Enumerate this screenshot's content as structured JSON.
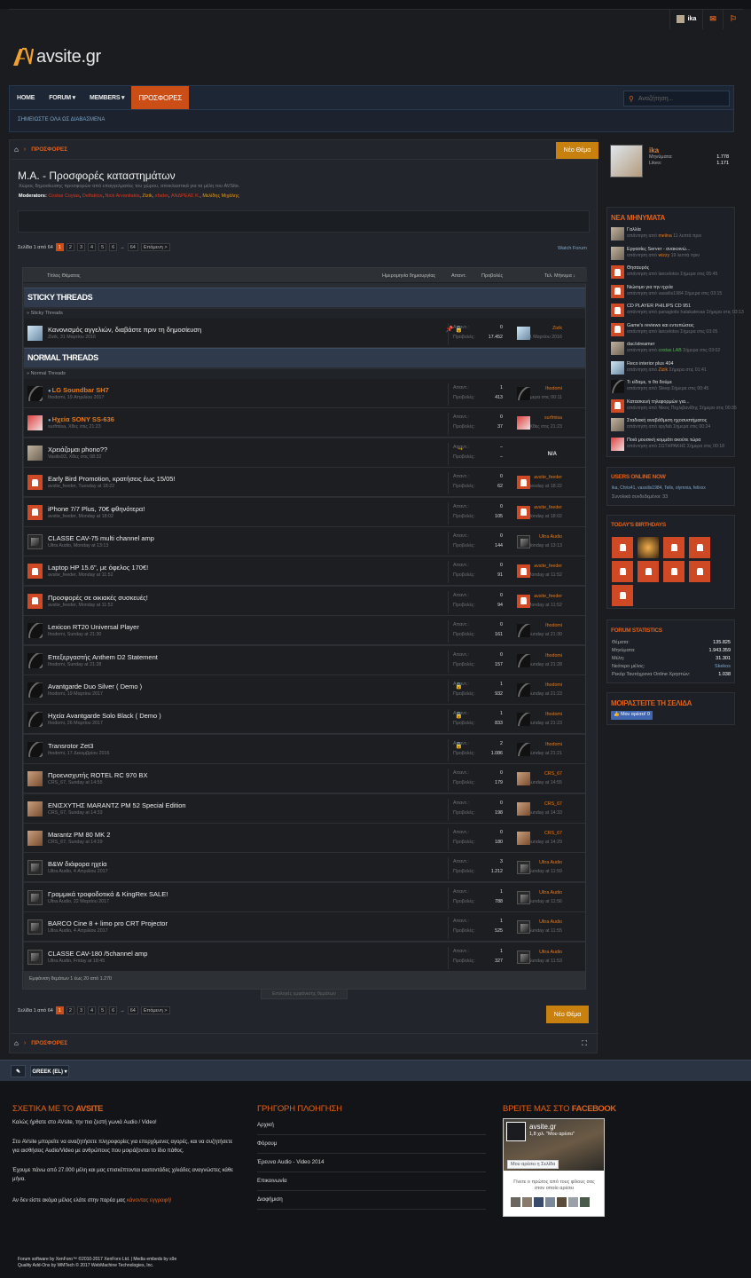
{
  "site": {
    "name": "avsite.gr"
  },
  "userbar": {
    "username": "ika"
  },
  "nav": {
    "items": [
      {
        "label": "HOME",
        "active": false
      },
      {
        "label": "FORUM ▾",
        "active": false
      },
      {
        "label": "MEMBERS ▾",
        "active": false
      },
      {
        "label": "ΠΡΟΣΦΟΡΕΣ",
        "active": true
      }
    ],
    "search_placeholder": "Αναζήτηση...",
    "subnav_link": "ΣΗΜΕΙΩΣΤΕ ΟΛΑ ΩΣ ΔΙΑΒΑΣΜΕΝΑ"
  },
  "breadcrumb": {
    "current": "ΠΡΟΣΦΟΡΕΣ"
  },
  "new_thread_label": "Νέο Θέμα",
  "forum": {
    "title": "Μ.Α. - Προσφορές καταστημάτων",
    "description": "Χώρος δημοσίευσης προσφορών από επαγγελματίες του χώρου, αποκλειστικά για τα μέλη του AVSite.",
    "moderators_label": "Moderators:",
    "moderators": [
      "Costas Coyias",
      "Delfaklos",
      "Nick Arvanitakis",
      "Zizik",
      "xfader",
      "ΑΝΔΡΕΑΣ Κ.",
      "Μελίδης Μιχάλης"
    ],
    "watch_label": "Watch Forum"
  },
  "pagination": {
    "label": "Σελίδα 1 από 64",
    "pages": [
      "1",
      "2",
      "3",
      "4",
      "5",
      "6",
      "→",
      "64"
    ],
    "next": "Επόμενη >"
  },
  "table": {
    "headers": {
      "title": "Τίτλος Θέματος",
      "created": "Ημερομηνία δημιουργίας",
      "replies": "Απαντ.",
      "views": "Προβολές",
      "last": "Τελ. Μήνυμα ↓"
    },
    "sticky_header": "STICKY THREADS",
    "sticky_sub": "» Sticky Threads",
    "normal_header": "NORMAL THREADS",
    "normal_sub": "» Normal Threads",
    "replies_label": "Απαντ.:",
    "views_label": "Προβολές:",
    "footer": "Εμφάνιση θεμάτων 1 έως 20 από 1.270",
    "select_label": "Επιλογές εμφάνισης θεμάτων"
  },
  "sticky_threads": [
    {
      "title": "Κανονισμός αγγελιών, διαβάστε πριν τη δημοσίευση",
      "meta": "Zizik, 31 Μαρτίου 2016",
      "icons": "📌 🔒",
      "replies": "0",
      "views": "17.452",
      "last_user": "Zizik",
      "last_time": "31 Μαρτίου 2016",
      "avatar": "zizik",
      "last_avatar": "zizik",
      "hl": false
    }
  ],
  "threads": [
    {
      "title": "LG Soundbar SH7",
      "meta": "Ihodomi, 19 Απριλίου 2017",
      "icons": "",
      "replies": "1",
      "views": "413",
      "last_user": "Ihodomi",
      "last_time": "Σήμερα στις 00:11",
      "avatar": "ihod",
      "last_avatar": "ihod",
      "hl": true,
      "dot": true
    },
    {
      "title": "Ηχεία SONY SS-636",
      "meta": "surfmisa, Χθες στις 21:23",
      "icons": "",
      "replies": "0",
      "views": "37",
      "last_user": "surfmisa",
      "last_time": "Χθες στις 21:23",
      "avatar": "surf",
      "last_avatar": "surf",
      "hl": true,
      "dot": true
    },
    {
      "title": "Χρειάζομαι phono??",
      "meta": "Vasilis93, Χθες στις 08:32",
      "icons": "↪",
      "replies": "–",
      "views": "–",
      "last_user": "",
      "last_time": "",
      "na": "N/A",
      "avatar": "vas",
      "last_avatar": "",
      "hl": false
    },
    {
      "title": "Early Bird Promotion, κρατήσεις έως 15/05!",
      "meta": "avsite_feeder, Tuesday at 18:22",
      "icons": "",
      "replies": "0",
      "views": "62",
      "last_user": "avsite_feeder",
      "last_time": "Tuesday at 18:22",
      "avatar": "def",
      "last_avatar": "def",
      "hl": false
    },
    {
      "title": "iPhone 7/7 Plus, 70€ φθηνότερα!",
      "meta": "avsite_feeder, Monday at 18:02",
      "icons": "",
      "replies": "0",
      "views": "105",
      "last_user": "avsite_feeder",
      "last_time": "Monday at 18:02",
      "avatar": "def",
      "last_avatar": "def",
      "hl": false
    },
    {
      "title": "CLASSE CAV-75 multi channel amp",
      "meta": "Ultra Audio, Monday at 13:13",
      "icons": "",
      "replies": "0",
      "views": "144",
      "last_user": "Ultra Audio",
      "last_time": "Monday at 13:13",
      "avatar": "ultra",
      "last_avatar": "ultra",
      "hl": false
    },
    {
      "title": "Laptop HP 15.6\", με όφελος 170€!",
      "meta": "avsite_feeder, Monday at 11:52",
      "icons": "",
      "replies": "0",
      "views": "91",
      "last_user": "avsite_feeder",
      "last_time": "Monday at 11:52",
      "avatar": "def",
      "last_avatar": "def",
      "hl": false
    },
    {
      "title": "Προσφορές σε οικιακές συσκευές!",
      "meta": "avsite_feeder, Monday at 11:52",
      "icons": "",
      "replies": "0",
      "views": "94",
      "last_user": "avsite_feeder",
      "last_time": "Monday at 11:52",
      "avatar": "def",
      "last_avatar": "def",
      "hl": false
    },
    {
      "title": "Lexicon RT20 Universal Player",
      "meta": "Ihodomi, Sunday at 21:30",
      "icons": "",
      "replies": "0",
      "views": "161",
      "last_user": "Ihodomi",
      "last_time": "Sunday at 21:30",
      "avatar": "ihod",
      "last_avatar": "ihod",
      "hl": false
    },
    {
      "title": "Επεξεργαστής Anthem D2 Statement",
      "meta": "Ihodomi, Sunday at 21:28",
      "icons": "",
      "replies": "0",
      "views": "157",
      "last_user": "Ihodomi",
      "last_time": "Sunday at 21:28",
      "avatar": "ihod",
      "last_avatar": "ihod",
      "hl": false
    },
    {
      "title": "Avantgarde Duo Silver ( Demo )",
      "meta": "Ihodomi, 19 Μαρτίου 2017",
      "icons": "🔒",
      "replies": "1",
      "views": "932",
      "last_user": "Ihodomi",
      "last_time": "Sunday at 21:23",
      "avatar": "ihod",
      "last_avatar": "ihod",
      "hl": false
    },
    {
      "title": "Ηχεία Avantgarde Solo Black ( Demo )",
      "meta": "Ihodomi, 26 Μαρτίου 2017",
      "icons": "🔒",
      "replies": "1",
      "views": "833",
      "last_user": "Ihodomi",
      "last_time": "Sunday at 21:23",
      "avatar": "ihod",
      "last_avatar": "ihod",
      "hl": false
    },
    {
      "title": "Transrotor Zet3",
      "meta": "Ihodomi, 17 Δεκεμβρίου 2016",
      "icons": "🔒",
      "replies": "2",
      "views": "1.086",
      "last_user": "Ihodomi",
      "last_time": "Sunday at 21:21",
      "avatar": "ihod",
      "last_avatar": "ihod",
      "hl": false
    },
    {
      "title": "Προενισχυτής ROTEL RC 970 BX",
      "meta": "CRS_67, Sunday at 14:55",
      "icons": "",
      "replies": "0",
      "views": "179",
      "last_user": "CRS_67",
      "last_time": "Sunday at 14:55",
      "avatar": "crs",
      "last_avatar": "crs",
      "hl": false
    },
    {
      "title": "ΕΝΙΣΧΥΤΗΣ MARANTZ PM 52 Special Edition",
      "meta": "CRS_67, Sunday at 14:33",
      "icons": "",
      "replies": "0",
      "views": "198",
      "last_user": "CRS_67",
      "last_time": "Sunday at 14:33",
      "avatar": "crs",
      "last_avatar": "crs",
      "hl": false
    },
    {
      "title": "Marantz PM 80 MK 2",
      "meta": "CRS_67, Sunday at 14:29",
      "icons": "",
      "replies": "0",
      "views": "180",
      "last_user": "CRS_67",
      "last_time": "Sunday at 14:29",
      "avatar": "crs",
      "last_avatar": "crs",
      "hl": false
    },
    {
      "title": "B&W διάφορα ηχεία",
      "meta": "Ultra Audio, 4 Απριλίου 2017",
      "icons": "",
      "replies": "3",
      "views": "1.212",
      "last_user": "Ultra Audio",
      "last_time": "Sunday at 11:59",
      "avatar": "ultra",
      "last_avatar": "ultra",
      "hl": false
    },
    {
      "title": "Γραμμικά τροφοδοτικά & KingRex SALE!",
      "meta": "Ultra Audio, 22 Μαρτίου 2017",
      "icons": "",
      "replies": "1",
      "views": "788",
      "last_user": "Ultra Audio",
      "last_time": "Sunday at 11:56",
      "avatar": "ultra",
      "last_avatar": "ultra",
      "hl": false
    },
    {
      "title": "BARCO Cine 8 + limo pro CRT Projector",
      "meta": "Ultra Audio, 4 Απριλίου 2017",
      "icons": "",
      "replies": "1",
      "views": "525",
      "last_user": "Ultra Audio",
      "last_time": "Sunday at 11:55",
      "avatar": "ultra",
      "last_avatar": "ultra",
      "hl": false
    },
    {
      "title": "CLASSE CAV-180 /5channel amp",
      "meta": "Ultra Audio, Friday at 18:45",
      "icons": "",
      "replies": "1",
      "views": "327",
      "last_user": "Ultra Audio",
      "last_time": "Sunday at 11:53",
      "avatar": "ultra",
      "last_avatar": "ultra",
      "hl": false
    }
  ],
  "sidebar": {
    "user": {
      "name": "ika",
      "messages_label": "Μηνύματα:",
      "messages": "1.778",
      "likes_label": "Likes:",
      "likes": "1.171"
    },
    "new_posts_title": "ΝΕΑ ΜΗΝΥΜΑΤΑ",
    "new_posts": [
      {
        "title": "Γαλλία",
        "by": "απάντηση από",
        "user": "melina",
        "time": "11 λεπτά πριν",
        "av": "vas"
      },
      {
        "title": "Εργασίες Server - ανακοινώ...",
        "by": "απάντηση από",
        "user": "wizzy",
        "time": "19 λεπτά πριν",
        "av": "vas"
      },
      {
        "title": "Θησαυρός",
        "by": "απάντηση από lancelotos",
        "user": "",
        "time": "Σήμερα στις 05:45",
        "av": "def"
      },
      {
        "title": "Νιώσιμο για την ηχεία",
        "by": "απάντηση από vassilis1984",
        "user": "",
        "time": "Σήμερα στις 03:15",
        "av": "def"
      },
      {
        "title": "CD PLAYER PHILIPS CD 951",
        "by": "απάντηση από panagiotis halakatevas",
        "user": "",
        "time": "Σήμερα στις 03:13",
        "av": "def"
      },
      {
        "title": "Game's reviews και εντυπώσεις",
        "by": "απάντηση από lancelotos",
        "user": "",
        "time": "Σήμερα στις 03:05",
        "av": "def"
      },
      {
        "title": "dac/streamer",
        "by": "απάντηση από",
        "user": "costas LAB",
        "time": "Σήμερα στις 03:02",
        "av": "vas",
        "green": true
      },
      {
        "title": "Reco interior plus 404",
        "by": "απάντηση από",
        "user": "Zizik",
        "time": "Σήμερα στις 01:41",
        "av": "zizik"
      },
      {
        "title": "Τι είδαμε, τι θα δούμε",
        "by": "απάντηση από Sleep",
        "user": "",
        "time": "Σήμερα στις 00:45",
        "av": "ihod"
      },
      {
        "title": "Κατασκευή τηλεφορμών για...",
        "by": "απάντηση από Νίκος Πεχλιβανίδης",
        "user": "",
        "time": "Σήμερα στις 00:35",
        "av": "def"
      },
      {
        "title": "Σταδιακή αναβάθμιση ηχοσυστήματος",
        "by": "απάντηση από spyfab",
        "user": "",
        "time": "Σήμερα στις 00:24",
        "av": "vas"
      },
      {
        "title": "Ποιά μουσική κομμάτι ακούτε τώρα",
        "by": "απάντηση από ΣΩΤΗΡΑΚΗΣ",
        "user": "",
        "time": "Σήμερα στις 00:18",
        "av": "surf"
      }
    ],
    "online_title": "USERS ONLINE NOW",
    "online_users": "ika, Chris41, vassilis1984, Tells, olymnia, felixxx",
    "online_count": "Συνολικά συνδεδεμένοι: 33",
    "birthdays_title": "TODAY'S BIRTHDAYS",
    "stats_title": "FORUM STATISTICS",
    "stats": [
      {
        "label": "Θέματα:",
        "value": "135.825"
      },
      {
        "label": "Μηνύματα:",
        "value": "1.943.359"
      },
      {
        "label": "Μέλη:",
        "value": "31.301"
      },
      {
        "label": "Νεότερο μέλος:",
        "value": "Skekos",
        "blue": true
      },
      {
        "label": "Ρεκόρ Ταυτόχρονα Online Χρηστών:",
        "value": "1.038"
      }
    ],
    "share_title": "ΜΟΙΡΑΣΤΕΙΤΕ ΤΗ ΣΕΛΙΔΑ",
    "fb_like": "👍 Μου αρέσει! 0"
  },
  "bottombar": {
    "lang": "GREEK (EL) ▾"
  },
  "footer": {
    "about_title_1": "ΣΧΕΤΙΚΑ ΜΕ ΤΟ ",
    "about_title_2": "AVSITE",
    "about_p1": "Καλώς ήρθατε στο AVsite, την πιο ζεστή γωνιά Audio / Video!",
    "about_p2": "Στο AVsite μπορείτε να αναζητήσετε πληροφορίες για επερχόμενες αγορές, και να συζητήσετε για αισθήσεις Audio/Video με ανθρώπους που μοιράζονται το ίδιο πάθος.",
    "about_p3": "Έχουμε πάνω από 27.000 μέλη και μας επισκέπτονται εκατοντάδες χιλιάδες αναγνώστες κάθε μήνα.",
    "about_p4a": "Αν δεν είστε ακόμα μέλος ελάτε στην παρέα μας ",
    "about_p4b": "κάνοντας εγγραφή!",
    "nav_title": "ΓΡΗΓΟΡΗ ΠΛΟΗΓΗΣΗ",
    "nav_links": [
      "Αρχική",
      "Φόρουμ",
      "Έρευνα Audio - Video 2014",
      "Επικοινωνία",
      "Διαφήμιση"
    ],
    "find_title_1": "ΒΡΕΙΤΕ ΜΑΣ ΣΤΟ ",
    "find_title_2": "FACEBOOK",
    "fb_name": "avsite.gr",
    "fb_likes": "1,8 χιλ. \"Μου αρέσει\"",
    "fb_btn": "Μου αρέσει η Σελίδα",
    "fb_text": "Γίνετε ο πρώτος από τους φίλους σας στον οποίο αρέσει",
    "copyright_1": "Forum software by XenForo™ ©2010-2017 XenForo Ltd. | Media embeds by s9e",
    "copyright_2": "Quality Add-Ons by WMTech © 2017 WebMachine Technologies, Inc."
  }
}
